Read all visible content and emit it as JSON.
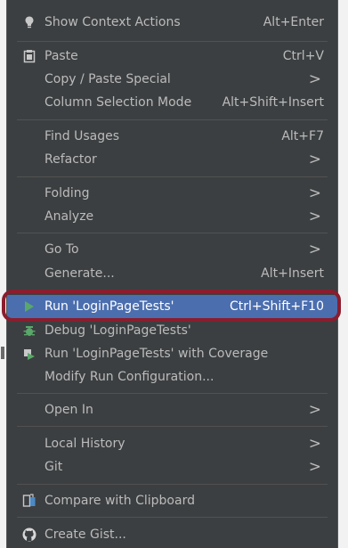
{
  "menu": {
    "items": [
      {
        "label": "Show Context Actions",
        "shortcut": "Alt+Enter",
        "icon": "lightbulb-icon"
      },
      {
        "label": "Paste",
        "shortcut": "Ctrl+V",
        "icon": "paste-icon"
      },
      {
        "label": "Copy / Paste Special",
        "submenu": true
      },
      {
        "label": "Column Selection Mode",
        "shortcut": "Alt+Shift+Insert"
      },
      {
        "label": "Find Usages",
        "shortcut": "Alt+F7"
      },
      {
        "label": "Refactor",
        "submenu": true
      },
      {
        "label": "Folding",
        "submenu": true
      },
      {
        "label": "Analyze",
        "submenu": true
      },
      {
        "label": "Go To",
        "submenu": true
      },
      {
        "label": "Generate...",
        "shortcut": "Alt+Insert"
      },
      {
        "label": "Run 'LoginPageTests'",
        "shortcut": "Ctrl+Shift+F10",
        "icon": "run-icon",
        "selected": true
      },
      {
        "label": "Debug 'LoginPageTests'",
        "icon": "debug-icon"
      },
      {
        "label": "Run 'LoginPageTests' with Coverage",
        "icon": "coverage-icon"
      },
      {
        "label": "Modify Run Configuration..."
      },
      {
        "label": "Open In",
        "submenu": true
      },
      {
        "label": "Local History",
        "submenu": true
      },
      {
        "label": "Git",
        "submenu": true
      },
      {
        "label": "Compare with Clipboard",
        "icon": "compare-icon"
      },
      {
        "label": "Create Gist...",
        "icon": "github-icon"
      }
    ],
    "submenu_arrow": ">"
  },
  "colors": {
    "menu_bg": "#3c3f41",
    "selection_bg": "#4b6eaf",
    "highlight_ring": "#8a1d2e"
  }
}
